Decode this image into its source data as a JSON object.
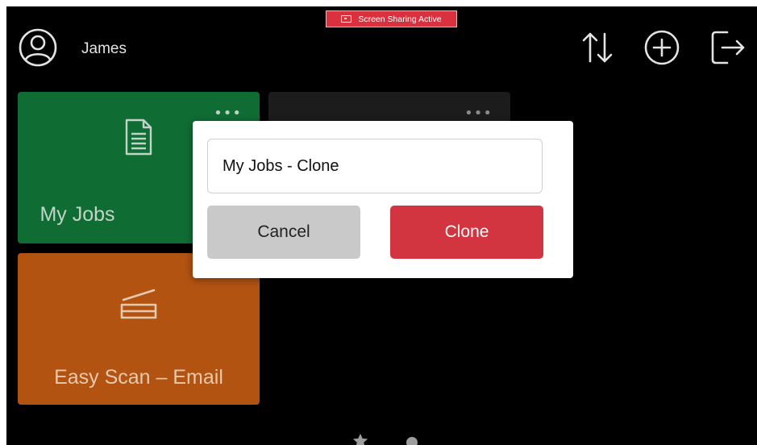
{
  "banner": {
    "label": "Screen Sharing Active",
    "icon": "monitor-icon"
  },
  "header": {
    "user_name": "James",
    "avatar_icon": "user-circle-icon",
    "actions": [
      {
        "icon": "sort-arrows-icon"
      },
      {
        "icon": "add-circle-icon"
      },
      {
        "icon": "logout-icon"
      }
    ]
  },
  "tiles": [
    {
      "label": "My Jobs",
      "icon": "document-icon",
      "color": "#0f6d33"
    },
    {
      "label": "",
      "icon": "",
      "color": "#1c1c1c"
    },
    {
      "label": "Easy Scan – Email",
      "icon": "scanner-icon",
      "color": "#b25312"
    }
  ],
  "tile_menu": "•••",
  "pager": {
    "items": [
      "star-icon",
      "page-dot"
    ]
  },
  "dialog": {
    "input_value": "My Jobs - Clone",
    "cancel_label": "Cancel",
    "clone_label": "Clone",
    "clone_color": "#d23440"
  }
}
